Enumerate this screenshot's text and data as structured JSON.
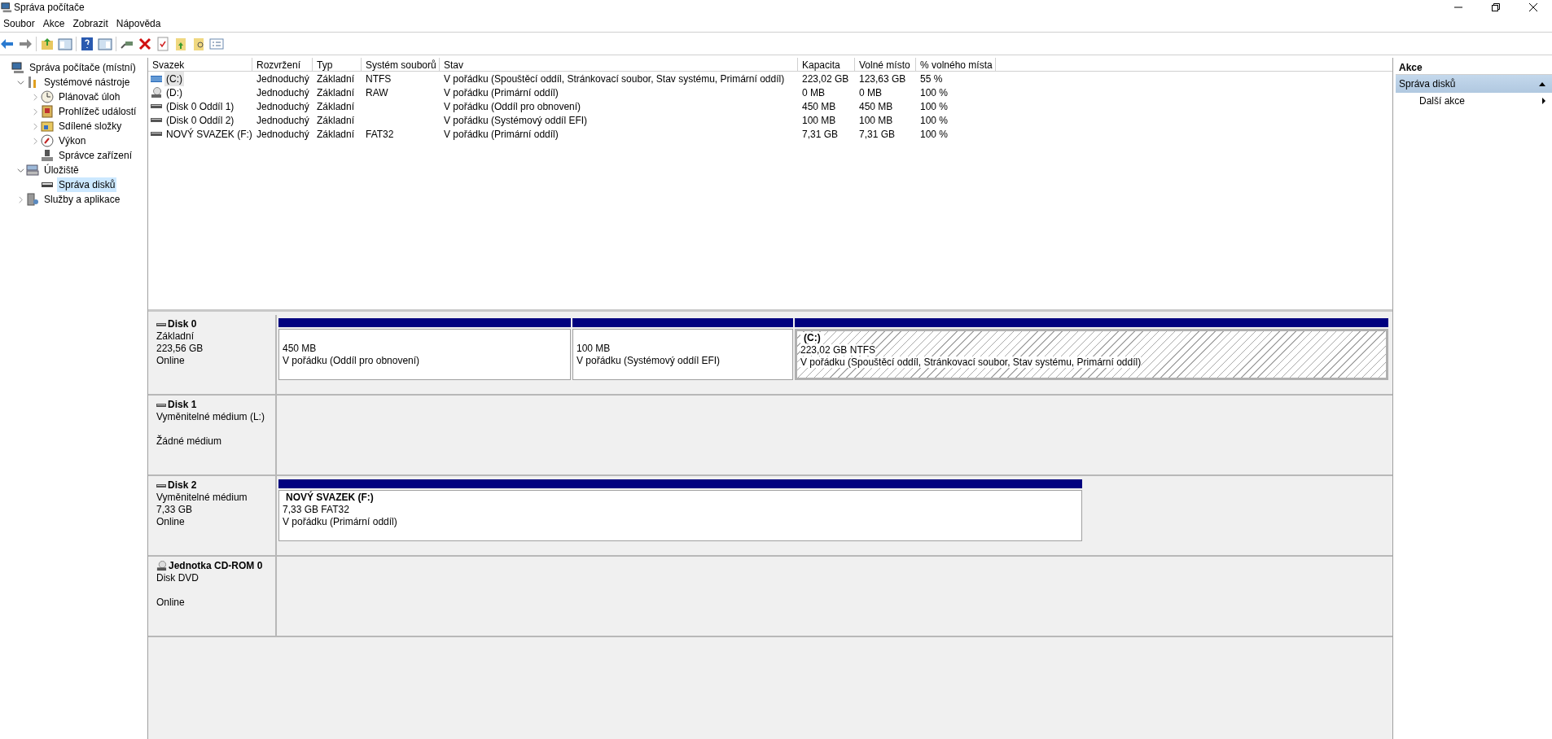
{
  "window": {
    "title": "Správa počítače"
  },
  "menu": [
    "Soubor",
    "Akce",
    "Zobrazit",
    "Nápověda"
  ],
  "tree": [
    {
      "label": "Správa počítače (místní)",
      "kind": "computer",
      "selected": false,
      "children": [
        {
          "label": "Systémové nástroje",
          "kind": "tools",
          "selected": false,
          "expanded": true,
          "children": [
            {
              "label": "Plánovač úloh",
              "kind": "clock",
              "selected": false,
              "expanded": false
            },
            {
              "label": "Prohlížeč událostí",
              "kind": "log",
              "selected": false,
              "expanded": false
            },
            {
              "label": "Sdílené složky",
              "kind": "share",
              "selected": false,
              "expanded": false
            },
            {
              "label": "Výkon",
              "kind": "perf",
              "selected": false,
              "expanded": false
            },
            {
              "label": "Správce zařízení",
              "kind": "device",
              "selected": false
            }
          ]
        },
        {
          "label": "Úložiště",
          "kind": "storage",
          "selected": false,
          "expanded": true,
          "children": [
            {
              "label": "Správa disků",
              "kind": "disk",
              "selected": true
            }
          ]
        },
        {
          "label": "Služby a aplikace",
          "kind": "services",
          "selected": false,
          "expanded": false
        }
      ]
    }
  ],
  "table": {
    "columns": [
      "Svazek",
      "Rozvržení",
      "Typ",
      "Systém souborů",
      "Stav",
      "Kapacita",
      "Volné místo",
      "% volného místa"
    ],
    "rows": [
      {
        "kind": "striped",
        "selected": true,
        "cells": [
          "(C:)",
          "Jednoduchý",
          "Základní",
          "NTFS",
          "V pořádku (Spouštěcí oddíl, Stránkovací soubor, Stav systému, Primární oddíl)",
          "223,02 GB",
          "123,63 GB",
          "55 %"
        ]
      },
      {
        "kind": "cdrom",
        "selected": false,
        "cells": [
          "(D:)",
          "Jednoduchý",
          "Základní",
          "RAW",
          "V pořádku (Primární oddíl)",
          "0 MB",
          "0 MB",
          "100 %"
        ]
      },
      {
        "kind": "disk",
        "selected": false,
        "cells": [
          "(Disk 0 Oddíl 1)",
          "Jednoduchý",
          "Základní",
          "",
          "V pořádku (Oddíl pro obnovení)",
          "450 MB",
          "450 MB",
          "100 %"
        ]
      },
      {
        "kind": "disk",
        "selected": false,
        "cells": [
          "(Disk 0 Oddíl 2)",
          "Jednoduchý",
          "Základní",
          "",
          "V pořádku (Systémový oddíl EFI)",
          "100 MB",
          "100 MB",
          "100 %"
        ]
      },
      {
        "kind": "disk",
        "selected": false,
        "cells": [
          "NOVÝ SVAZEK (F:)",
          "Jednoduchý",
          "Základní",
          "FAT32",
          "V pořádku (Primární oddíl)",
          "7,31 GB",
          "7,31 GB",
          "100 %"
        ]
      }
    ]
  },
  "disks": [
    {
      "name": "Disk 0",
      "kind": "disk",
      "type": "Základní",
      "size": "223,56 GB",
      "status": "Online",
      "partitions": [
        {
          "size": "450 MB",
          "status": "V pořádku (Oddíl pro obnovení)",
          "selected": false
        },
        {
          "size": "100 MB",
          "status": "V pořádku (Systémový oddíl EFI)",
          "selected": false
        },
        {
          "title": "(C:)",
          "size": "223,02 GB NTFS",
          "status": "V pořádku (Spouštěcí oddíl, Stránkovací soubor, Stav systému, Primární oddíl)",
          "selected": true
        }
      ]
    },
    {
      "name": "Disk 1",
      "kind": "disk",
      "type": "Vyměnitelné médium (L:)",
      "status": "Žádné médium"
    },
    {
      "name": "Disk 2",
      "kind": "disk",
      "type": "Vyměnitelné médium",
      "size": "7,33 GB",
      "status": "Online",
      "partitions": [
        {
          "title": "NOVÝ SVAZEK  (F:)",
          "size": "7,33 GB FAT32",
          "status": "V pořádku (Primární oddíl)",
          "selected": false
        }
      ]
    },
    {
      "name": "Jednotka CD-ROM 0",
      "kind": "cdrom",
      "type": "Disk DVD",
      "status": "Online"
    }
  ],
  "actions": {
    "title": "Akce",
    "sections": [
      {
        "label": "Správa disků",
        "expanded": true,
        "items": [
          "Další akce"
        ]
      }
    ]
  }
}
